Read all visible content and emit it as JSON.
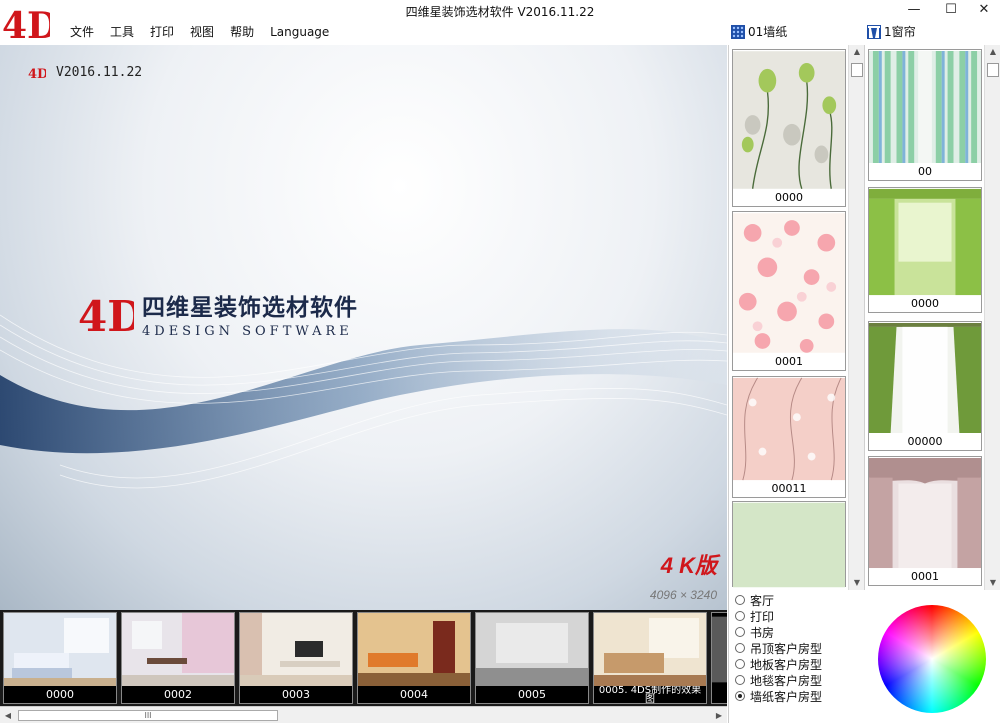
{
  "window": {
    "title": "四维星装饰选材软件  V2016.11.22",
    "minimize": "—",
    "maximize": "☐",
    "close": "✕"
  },
  "menu": {
    "items": [
      "文件",
      "工具",
      "打印",
      "视图",
      "帮助",
      "Language"
    ]
  },
  "panel_tabs": {
    "wallpaper": "01墙纸",
    "curtain": "1窗帘"
  },
  "canvas": {
    "version": "V2016.11.22",
    "brand_cn": "四维星装饰选材软件",
    "brand_en": "4DESIGN SOFTWARE",
    "edition": "4 K版",
    "resolution": "4096 × 3240"
  },
  "wallpapers": [
    {
      "label": "0000"
    },
    {
      "label": "0001"
    },
    {
      "label": "00011"
    },
    {
      "label": ""
    }
  ],
  "curtains": [
    {
      "label": "00"
    },
    {
      "label": "0000"
    },
    {
      "label": "00000"
    },
    {
      "label": "0001"
    }
  ],
  "rooms": [
    {
      "label": "0000"
    },
    {
      "label": "0002"
    },
    {
      "label": "0003"
    },
    {
      "label": "0004"
    },
    {
      "label": "0005"
    },
    {
      "label": "0005. 4DS制作的效果图"
    }
  ],
  "room_types": [
    {
      "label": "客厅",
      "selected": false
    },
    {
      "label": "打印",
      "selected": false
    },
    {
      "label": "书房",
      "selected": false
    },
    {
      "label": "吊顶客户房型",
      "selected": false
    },
    {
      "label": "地板客户房型",
      "selected": false
    },
    {
      "label": "地毯客户房型",
      "selected": false
    },
    {
      "label": "墙纸客户房型",
      "selected": true
    }
  ],
  "scrollbar_grip": "III",
  "colors": {
    "brand_red": "#d0161b",
    "brand_navy": "#1c2a4a"
  }
}
